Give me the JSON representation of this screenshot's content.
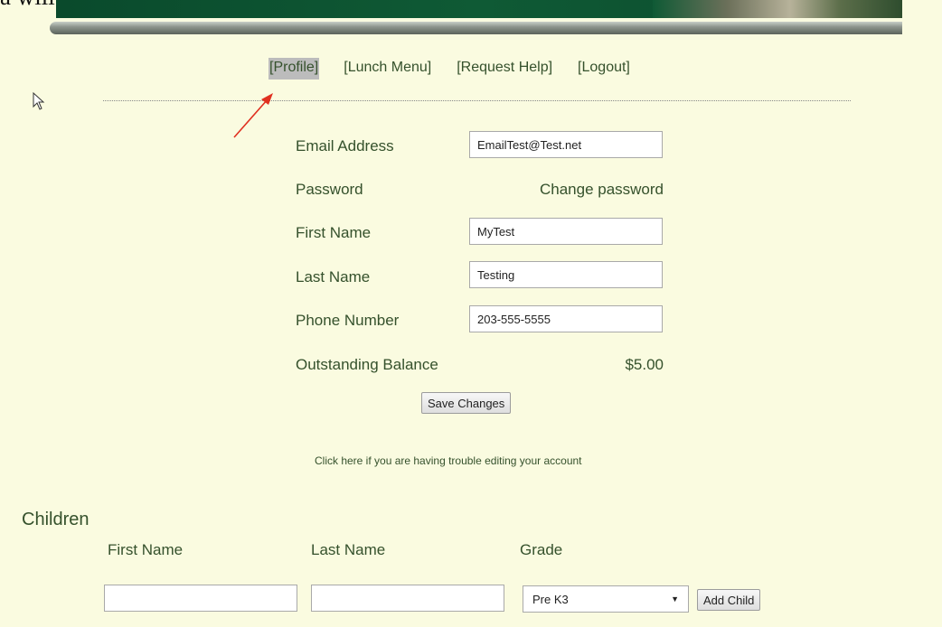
{
  "top_caption": "a will be taken to your profile page",
  "nav": {
    "items": [
      {
        "label": "[Profile]",
        "active": true
      },
      {
        "label": "[Lunch Menu]"
      },
      {
        "label": "[Request Help]"
      },
      {
        "label": "[Logout]"
      }
    ]
  },
  "profile": {
    "email_label": "Email Address",
    "email_value": "EmailTest@Test.net",
    "password_label": "Password",
    "change_password_link": "Change password",
    "first_name_label": "First Name",
    "first_name_value": "MyTest",
    "last_name_label": "Last Name",
    "last_name_value": "Testing",
    "phone_label": "Phone Number",
    "phone_value": "203-555-5555",
    "balance_label": "Outstanding Balance",
    "balance_value": "$5.00",
    "save_button": "Save Changes",
    "trouble_link": "Click here if you are having trouble editing your account"
  },
  "children": {
    "heading": "Children",
    "columns": [
      "First Name",
      "Last Name",
      "Grade"
    ],
    "first_name_value": "",
    "last_name_value": "",
    "grade_selected": "Pre K3",
    "add_button": "Add Child"
  },
  "colors": {
    "background": "#fafbe0",
    "text": "#35512c",
    "banner": "#0f5a35",
    "annotation_arrow": "#e03020"
  },
  "icons": {
    "cursor": "mouse-pointer-icon",
    "annotation": "red-arrow-icon",
    "dropdown": "caret-down-icon"
  }
}
